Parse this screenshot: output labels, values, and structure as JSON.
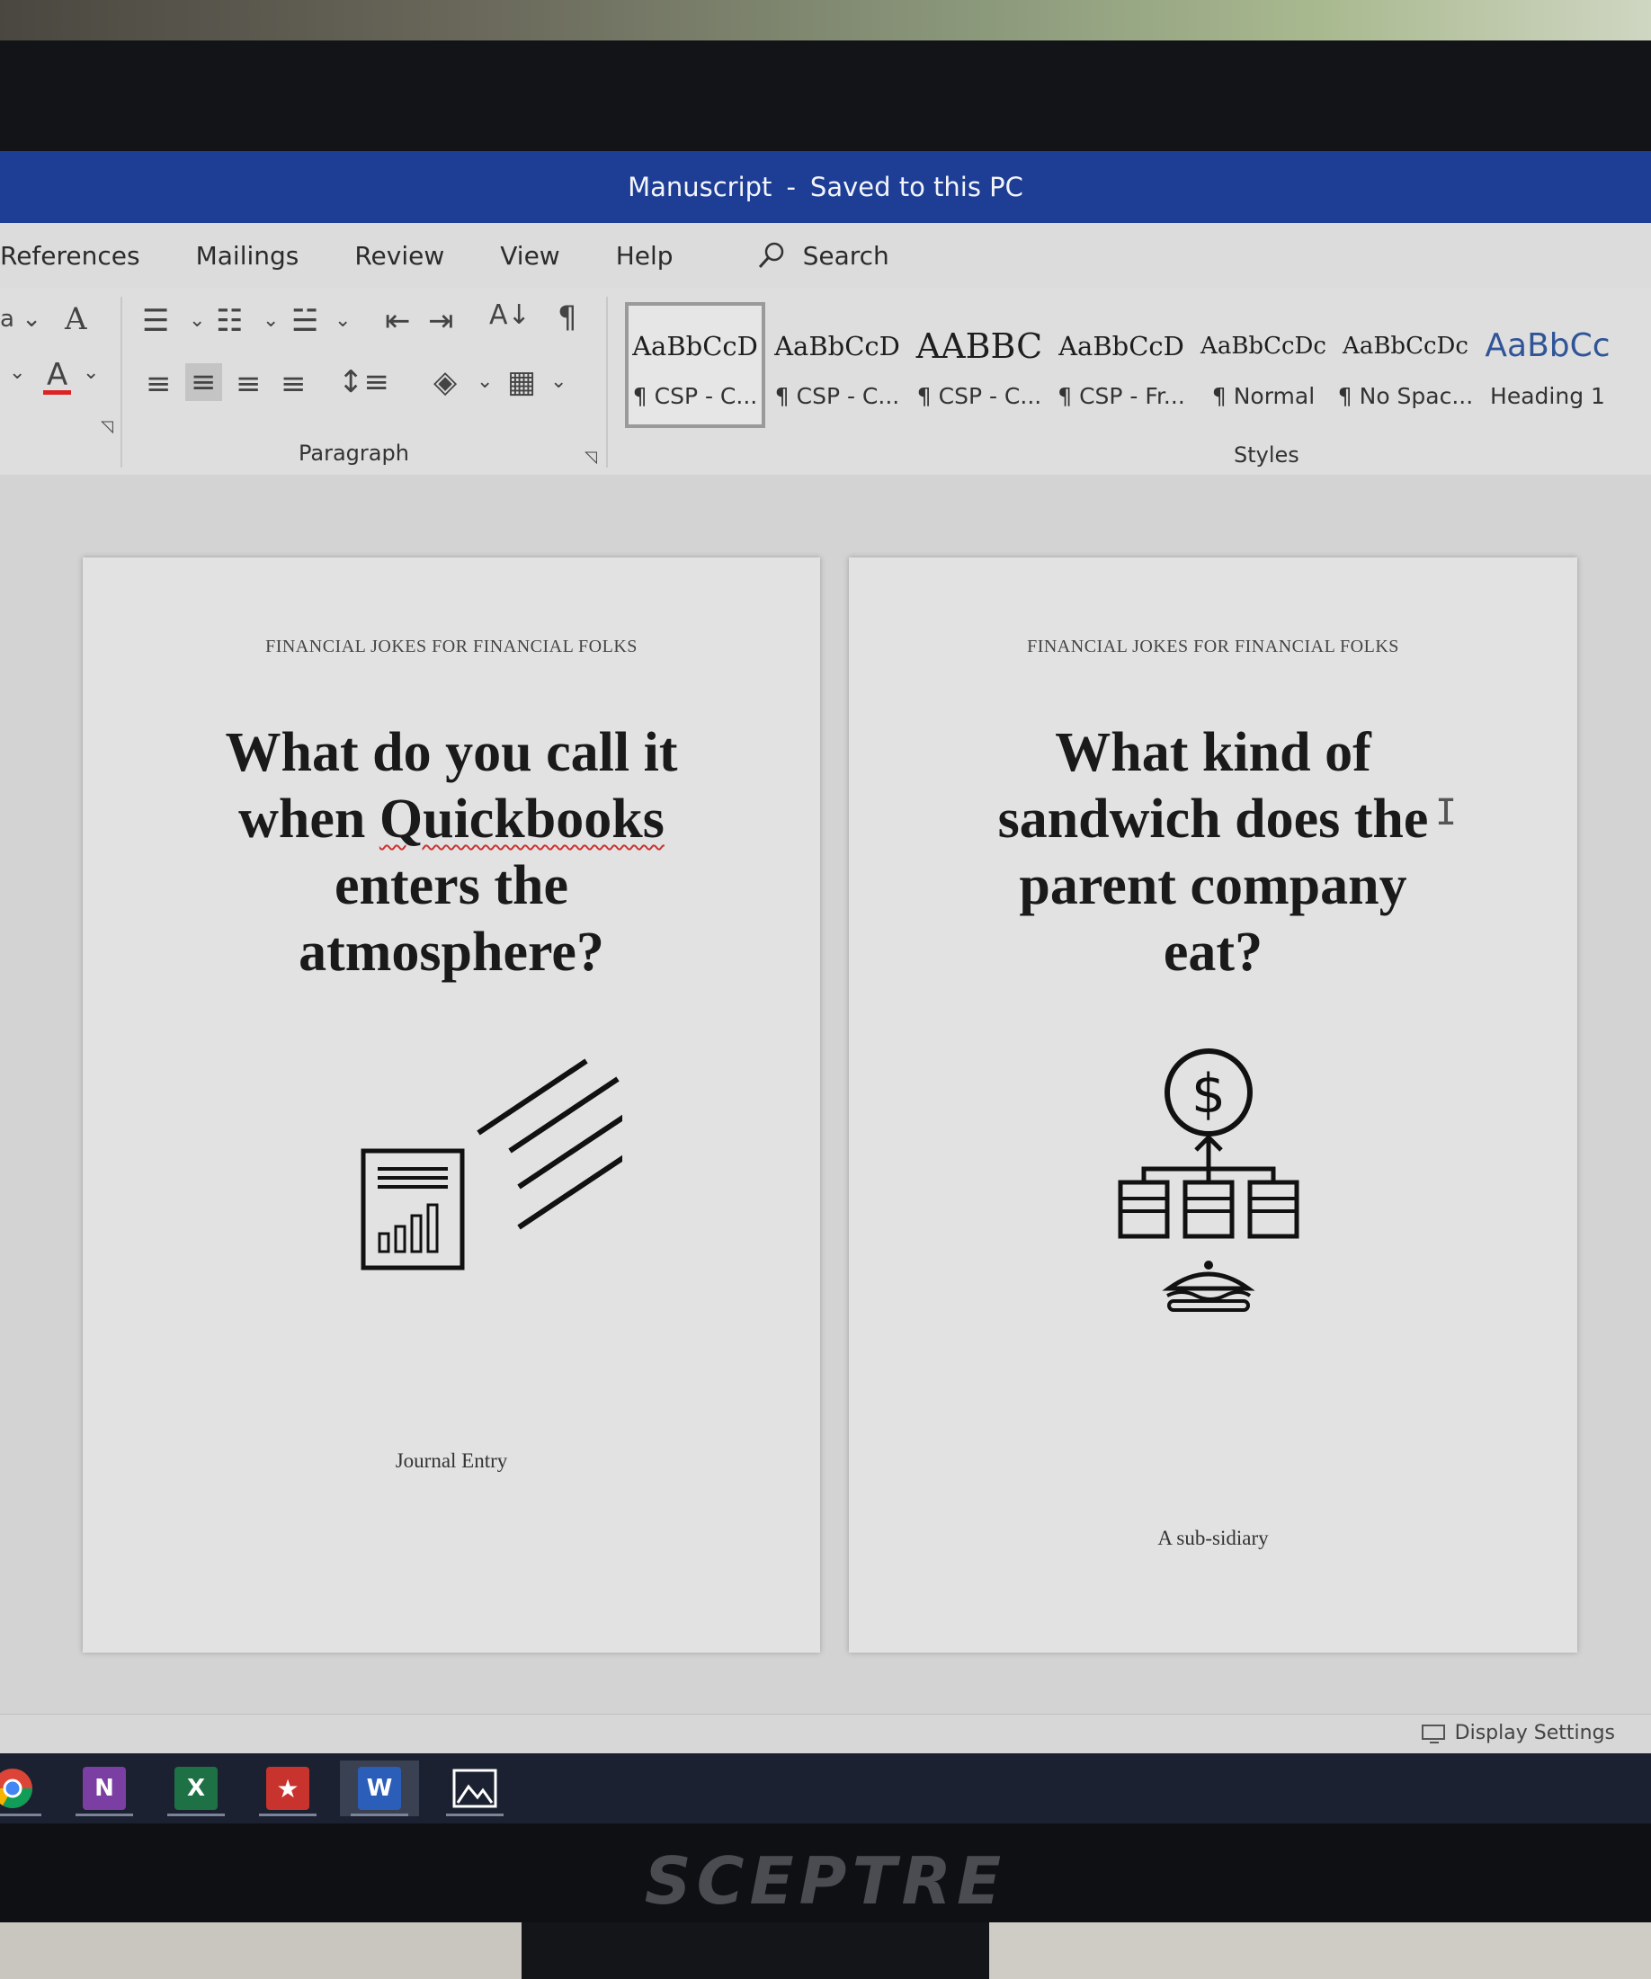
{
  "window": {
    "title": "Manuscript",
    "separator": "-",
    "save_status": "Saved to this PC"
  },
  "ribbon_tabs": [
    "References",
    "Mailings",
    "Review",
    "View",
    "Help"
  ],
  "search": {
    "label": "Search"
  },
  "groups": {
    "paragraph": "Paragraph",
    "styles": "Styles"
  },
  "styles": [
    {
      "sample": "AaBbCcD",
      "name": "¶ CSP - C...",
      "selected": true
    },
    {
      "sample": "AaBbCcD",
      "name": "¶ CSP - C..."
    },
    {
      "sample": "AABBC",
      "name": "¶ CSP - C..."
    },
    {
      "sample": "AaBbCcD",
      "name": "¶ CSP - Fr..."
    },
    {
      "sample": "AaBbCcDc",
      "name": "¶ Normal"
    },
    {
      "sample": "AaBbCcDc",
      "name": "¶ No Spac..."
    },
    {
      "sample": "AaBbCc",
      "name": "Heading 1"
    }
  ],
  "pages": [
    {
      "header": "FINANCIAL JOKES FOR FINANCIAL FOLKS",
      "question_l1": "What do you call it",
      "question_l2a": "when ",
      "question_l2b": "Quickbooks",
      "question_l3": "enters the",
      "question_l4": "atmosphere?",
      "answer": "Journal Entry"
    },
    {
      "header": "FINANCIAL JOKES FOR FINANCIAL FOLKS",
      "question_l1": "What kind of",
      "question_l2": "sandwich does the",
      "question_l3": "parent company",
      "question_l4": "eat?",
      "answer": "A sub-sidiary"
    }
  ],
  "statusbar": {
    "display_settings": "Display Settings"
  },
  "taskbar": {
    "apps": [
      "chrome-icon",
      "onenote-icon",
      "excel-icon",
      "acrobat-icon",
      "word-icon",
      "photos-icon"
    ],
    "onenote_letter": "N",
    "excel_letter": "X",
    "word_letter": "W"
  },
  "monitor": {
    "brand": "SCEPTRE"
  },
  "colors": {
    "titlebar": "#1e3e96",
    "excel": "#1e7145",
    "onenote": "#7b3fa3",
    "word": "#2b5eb8",
    "acrobat": "#c9332d"
  }
}
